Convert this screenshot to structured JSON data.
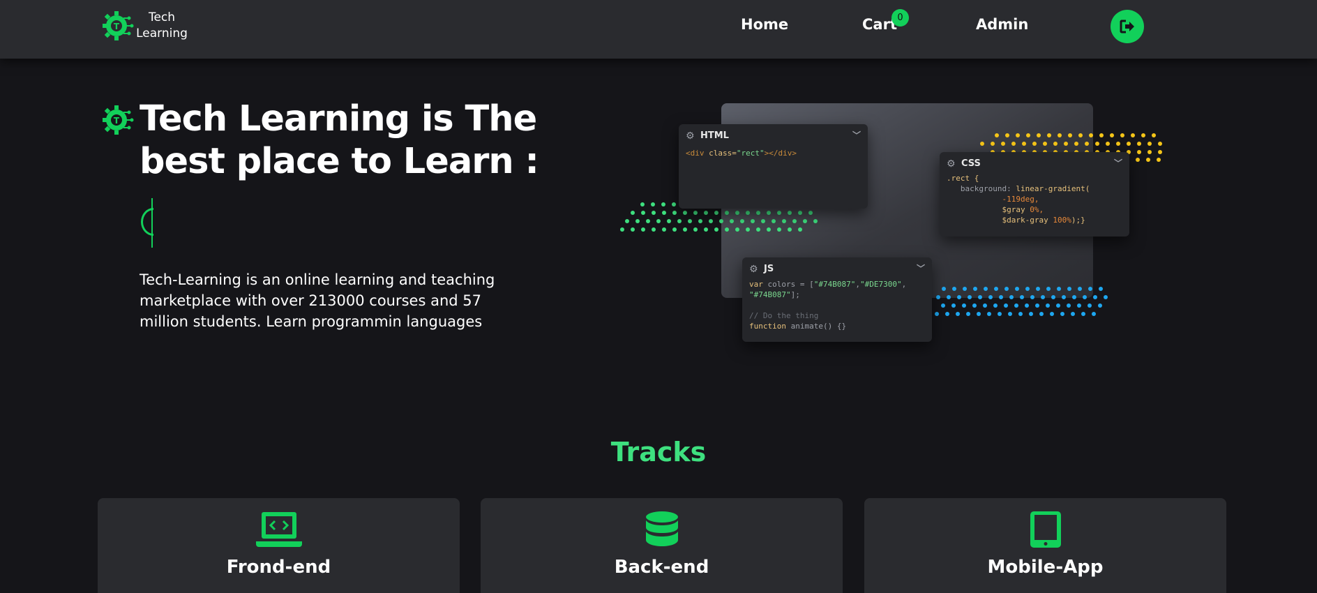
{
  "navbar": {
    "logo_text_line1": "Tech",
    "logo_text_line2": "Learning",
    "links": [
      {
        "label": "Home"
      },
      {
        "label": "Cart"
      },
      {
        "label": "Admin"
      }
    ],
    "cart_count": "0",
    "logout_icon": "sign-out-icon"
  },
  "hero": {
    "title": "Tech Learning is The best place to Learn :",
    "description": "Tech-Learning is an online learning and teaching marketplace with over 213000 courses and 57 million students. Learn programmin languages"
  },
  "code_panels": {
    "html": {
      "title": "HTML",
      "line1_tag_open": "<div ",
      "line1_attr": "class=",
      "line1_str": "\"rect\"",
      "line1_tag_close": "></div>"
    },
    "css": {
      "title": "CSS",
      "line1": ".rect {",
      "line2_key": "background:",
      "line2_val": " linear-gradient(",
      "line3": "-119deg,",
      "line4_var": "$gray",
      "line4_num": " 0%,",
      "line5_var": "$dark-gray",
      "line5_num": " 100%",
      "line5_end": ");}"
    },
    "js": {
      "title": "JS",
      "line1_kw": "var",
      "line1_rest": " colors = [",
      "line1_s1": "\"#74B087\"",
      "line1_s2": "\"#DE7300\"",
      "line1_s3": "\"#74B087\"",
      "line1_end": "];",
      "comment": "// Do the thing",
      "fn_kw": "function",
      "fn_rest": " animate() {}"
    }
  },
  "tracks": {
    "title": "Tracks",
    "items": [
      {
        "name": "Frond-end",
        "icon": "laptop-code-icon"
      },
      {
        "name": "Back-end",
        "icon": "database-icon"
      },
      {
        "name": "Mobile-App",
        "icon": "tablet-icon"
      }
    ]
  },
  "colors": {
    "accent": "#12d05a",
    "background": "#151519",
    "navbar": "#2a2b2f",
    "card": "#2a2b2f",
    "tracks_title": "#3ee07f",
    "dots_green": "#3ee07f",
    "dots_yellow": "#f5c518",
    "dots_blue": "#1ea7f0"
  }
}
